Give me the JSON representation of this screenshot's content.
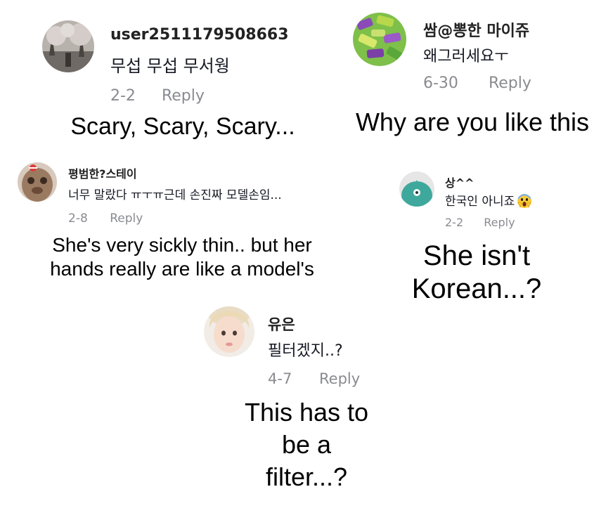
{
  "comments": [
    {
      "username": "user2511179508663",
      "text": "무섭 무섭 무서웡",
      "date": "2-2",
      "reply": "Reply",
      "caption": "Scary, Scary, Scary..."
    },
    {
      "username": "쌈@뽕한 마이쥬",
      "text": "왜그러세요ㅜ",
      "date": "6-30",
      "reply": "Reply",
      "caption": "Why are you like this"
    },
    {
      "username": "평범한?스테이",
      "text": "너무 말랐다 ㅠㅜㅠ근데 손진짜 모델손임...",
      "date": "2-8",
      "reply": "Reply",
      "caption_line1": "She's very sickly thin.. but her",
      "caption_line2": "hands really are like a model's"
    },
    {
      "username": "상^^",
      "text": "한국인 아니죠",
      "emoji": "screaming-face-emoji",
      "date": "2-2",
      "reply": "Reply",
      "caption_line1": "She isn't",
      "caption_line2": "Korean...?"
    },
    {
      "username": "유은",
      "text": "필터겠지..?",
      "date": "4-7",
      "reply": "Reply",
      "caption_line1": "This has to",
      "caption_line2": "be a",
      "caption_line3": "filter...?"
    }
  ],
  "colors": {
    "meta_gray": "#8a8b91",
    "text": "#161823",
    "avatar_teal": "#3fa89c"
  }
}
